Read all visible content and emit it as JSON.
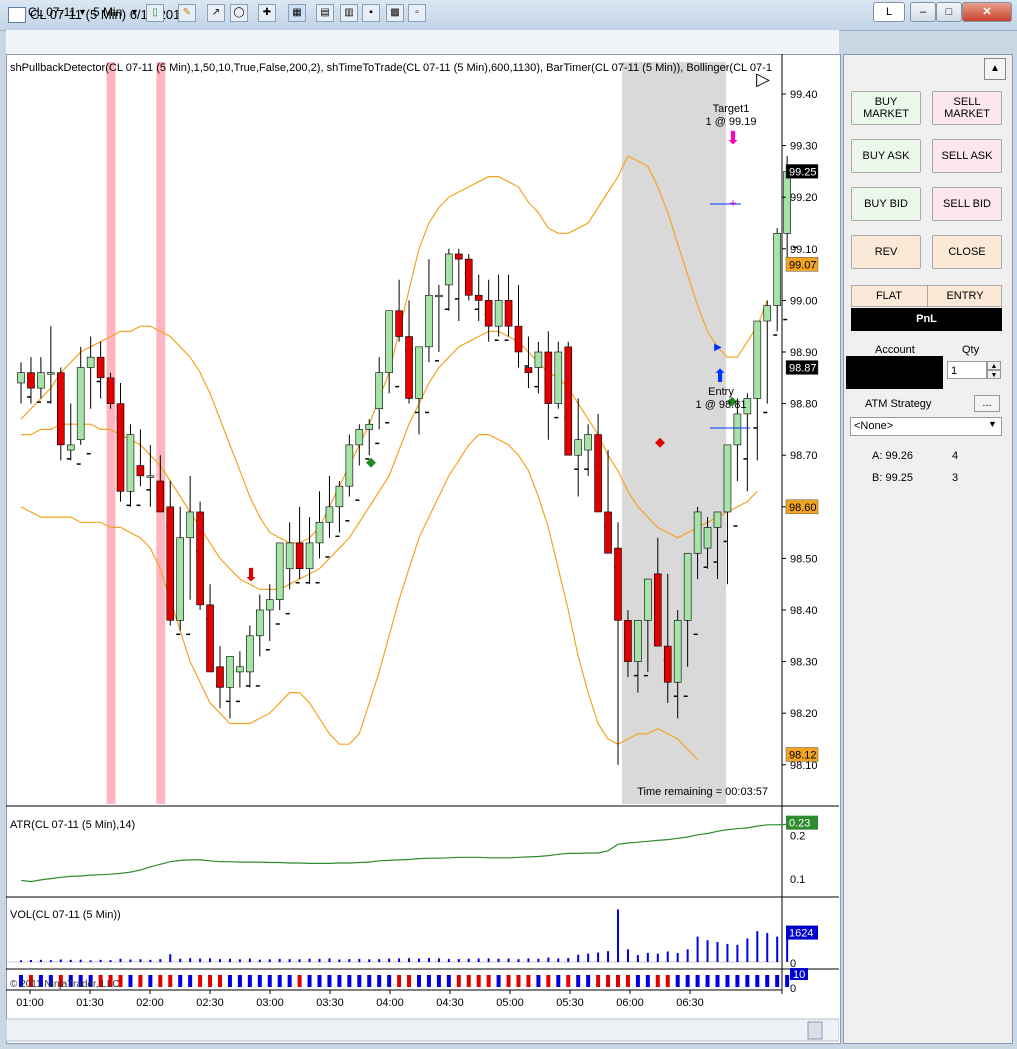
{
  "window": {
    "title": "CL 07-11 (5 Min)  6/15/2011",
    "link_button": "L"
  },
  "toolbar": {
    "instrument": "CL 07-11",
    "interval": "5 Min"
  },
  "chart": {
    "indicator_label": "shPullbackDetector(CL 07-11 (5 Min),1,50,10,True,False,200,2), shTimeToTrade(CL 07-11 (5 Min),600,1130), BarTimer(CL 07-11 (5 Min)), Bollinger(CL 07-1",
    "time_remaining": "Time remaining = 00:03:57",
    "target_label": "Target1",
    "target_qty": "1 @ 99.19",
    "entry_label": "Entry",
    "entry_qty": "1 @ 98.81",
    "copyright": "© 2011 NinjaTrader, LLC",
    "price_ticks": [
      "99.40",
      "99.30",
      "99.20",
      "99.10",
      "99.00",
      "98.90",
      "98.80",
      "98.70",
      "98.60",
      "98.50",
      "98.40",
      "98.30",
      "98.20",
      "98.10"
    ],
    "price_badges": [
      {
        "text": "99.25",
        "price": 99.25,
        "bg": "#000000",
        "fg": "#ffffff"
      },
      {
        "text": "99.07",
        "price": 99.07,
        "bg": "#f3a423",
        "fg": "#000000"
      },
      {
        "text": "98.87",
        "price": 98.87,
        "bg": "#000000",
        "fg": "#ffffff"
      },
      {
        "text": "98.60",
        "price": 98.6,
        "bg": "#f3a423",
        "fg": "#000000"
      },
      {
        "text": "98.12",
        "price": 98.12,
        "bg": "#f3a423",
        "fg": "#000000"
      }
    ],
    "time_labels": [
      "01:00",
      "01:30",
      "02:00",
      "02:30",
      "03:00",
      "03:30",
      "04:00",
      "04:30",
      "05:00",
      "05:30",
      "06:00",
      "06:30"
    ],
    "atr_label": "ATR(CL 07-11 (5 Min),14)",
    "atr_ticks": [
      "0.2",
      "0.1"
    ],
    "atr_badge": "0.23",
    "vol_label": "VOL(CL 07-11 (5 Min))",
    "vol_tick": "0",
    "vol_badge": "1624",
    "bottom_ticks": [
      "10",
      "0"
    ],
    "colors": {
      "up": "#a6e3a6",
      "down": "#e00000",
      "band": "#f3a423",
      "atr": "#2e8b2e",
      "vol": "#0000e0",
      "highlight": "#ffb6c1",
      "session": "#d9d9d9"
    }
  },
  "order_panel": {
    "buy_market": "BUY MARKET",
    "sell_market": "SELL MARKET",
    "buy_ask": "BUY ASK",
    "sell_ask": "SELL ASK",
    "buy_bid": "BUY BID",
    "sell_bid": "SELL BID",
    "rev": "REV",
    "close": "CLOSE",
    "flat": "FLAT",
    "entry": "ENTRY",
    "pnl": "PnL",
    "account_label": "Account",
    "qty_label": "Qty",
    "qty_value": "1",
    "atm_label": "ATM Strategy",
    "atm_more": "...",
    "atm_value": "<None>",
    "ask_label": "A: 99.26",
    "ask_size": "4",
    "bid_label": "B: 99.25",
    "bid_size": "3"
  },
  "chart_data": {
    "type": "candlestick",
    "title": "",
    "xlabel": "",
    "ylabel": "",
    "ylim": [
      98.06,
      99.5
    ],
    "x_ticks": [
      "01:00",
      "01:30",
      "02:00",
      "02:30",
      "03:00",
      "03:30",
      "04:00",
      "04:30",
      "05:00",
      "05:30",
      "06:00",
      "06:30"
    ],
    "bars_ohlc": [
      [
        98.84,
        98.88,
        98.8,
        98.86
      ],
      [
        98.86,
        98.89,
        98.8,
        98.83
      ],
      [
        98.83,
        98.89,
        98.81,
        98.86
      ],
      [
        98.86,
        98.95,
        98.8,
        98.86
      ],
      [
        98.86,
        98.87,
        98.69,
        98.72
      ],
      [
        98.71,
        98.8,
        98.69,
        98.72
      ],
      [
        98.73,
        98.91,
        98.72,
        98.87
      ],
      [
        98.87,
        98.93,
        98.79,
        98.89
      ],
      [
        98.89,
        98.92,
        98.81,
        98.85
      ],
      [
        98.85,
        98.86,
        98.79,
        98.8
      ],
      [
        98.8,
        98.84,
        98.61,
        98.63
      ],
      [
        98.63,
        98.76,
        98.6,
        98.74
      ],
      [
        98.68,
        98.75,
        98.64,
        98.66
      ],
      [
        98.66,
        98.72,
        98.6,
        98.66
      ],
      [
        98.65,
        98.7,
        98.6,
        98.59
      ],
      [
        98.6,
        98.65,
        98.37,
        98.38
      ],
      [
        98.38,
        98.6,
        98.36,
        98.54
      ],
      [
        98.54,
        98.66,
        98.42,
        98.59
      ],
      [
        98.59,
        98.61,
        98.4,
        98.41
      ],
      [
        98.41,
        98.45,
        98.35,
        98.28
      ],
      [
        98.29,
        98.33,
        98.21,
        98.25
      ],
      [
        98.25,
        98.31,
        98.19,
        98.31
      ],
      [
        98.28,
        98.32,
        98.25,
        98.29
      ],
      [
        98.28,
        98.37,
        98.25,
        98.35
      ],
      [
        98.35,
        98.43,
        98.31,
        98.4
      ],
      [
        98.4,
        98.45,
        98.34,
        98.42
      ],
      [
        98.42,
        98.53,
        98.4,
        98.53
      ],
      [
        98.48,
        98.57,
        98.44,
        98.53
      ],
      [
        98.53,
        98.6,
        98.46,
        98.48
      ],
      [
        98.48,
        98.58,
        98.45,
        98.53
      ],
      [
        98.53,
        98.63,
        98.5,
        98.57
      ],
      [
        98.57,
        98.66,
        98.54,
        98.6
      ],
      [
        98.6,
        98.65,
        98.55,
        98.64
      ],
      [
        98.64,
        98.74,
        98.62,
        98.72
      ],
      [
        98.72,
        98.76,
        98.68,
        98.75
      ],
      [
        98.75,
        98.77,
        98.7,
        98.76
      ],
      [
        98.79,
        98.89,
        98.75,
        98.86
      ],
      [
        98.86,
        98.97,
        98.82,
        98.98
      ],
      [
        98.98,
        99.04,
        98.92,
        98.93
      ],
      [
        98.93,
        99.0,
        98.8,
        98.81
      ],
      [
        98.81,
        98.91,
        98.74,
        98.91
      ],
      [
        98.91,
        99.08,
        98.88,
        99.01
      ],
      [
        99.01,
        99.03,
        98.9,
        99.01
      ],
      [
        99.03,
        99.1,
        98.98,
        99.09
      ],
      [
        99.09,
        99.1,
        98.96,
        99.08
      ],
      [
        99.08,
        99.09,
        99.0,
        99.01
      ],
      [
        99.01,
        99.05,
        98.96,
        99.0
      ],
      [
        99.0,
        99.04,
        98.92,
        98.95
      ],
      [
        98.95,
        99.05,
        98.93,
        99.0
      ],
      [
        99.0,
        99.05,
        98.93,
        98.95
      ],
      [
        98.95,
        99.03,
        98.87,
        98.9
      ],
      [
        98.87,
        98.93,
        98.83,
        98.86
      ],
      [
        98.87,
        98.92,
        98.82,
        98.9
      ],
      [
        98.9,
        98.94,
        98.73,
        98.8
      ],
      [
        98.8,
        98.92,
        98.79,
        98.9
      ],
      [
        98.91,
        98.92,
        98.72,
        98.7
      ],
      [
        98.7,
        98.81,
        98.62,
        98.73
      ],
      [
        98.71,
        98.76,
        98.66,
        98.74
      ],
      [
        98.74,
        98.78,
        98.6,
        98.59
      ],
      [
        98.59,
        98.71,
        98.52,
        98.51
      ],
      [
        98.52,
        98.57,
        98.1,
        98.38
      ],
      [
        98.38,
        98.4,
        98.27,
        98.3
      ],
      [
        98.3,
        98.38,
        98.24,
        98.38
      ],
      [
        98.38,
        98.45,
        98.28,
        98.46
      ],
      [
        98.47,
        98.54,
        98.34,
        98.33
      ],
      [
        98.33,
        98.47,
        98.22,
        98.26
      ],
      [
        98.26,
        98.4,
        98.19,
        98.38
      ],
      [
        98.38,
        98.5,
        98.29,
        98.51
      ],
      [
        98.51,
        98.6,
        98.46,
        98.59
      ],
      [
        98.52,
        98.58,
        98.48,
        98.56
      ],
      [
        98.56,
        98.59,
        98.46,
        98.59
      ],
      [
        98.59,
        98.67,
        98.45,
        98.72
      ],
      [
        98.72,
        98.81,
        98.65,
        98.78
      ],
      [
        98.78,
        98.82,
        98.63,
        98.81
      ],
      [
        98.81,
        98.9,
        98.69,
        98.96
      ],
      [
        98.96,
        99.0,
        98.8,
        98.99
      ],
      [
        98.99,
        99.14,
        98.94,
        99.13
      ],
      [
        99.13,
        99.28,
        99.08,
        99.25
      ]
    ],
    "atr_range": [
      0.07,
      0.25
    ],
    "atr_series": [
      0.097,
      0.094,
      0.098,
      0.101,
      0.104,
      0.106,
      0.107,
      0.109,
      0.11,
      0.111,
      0.113,
      0.116,
      0.121,
      0.128,
      0.134,
      0.14,
      0.143,
      0.144,
      0.144,
      0.142,
      0.14,
      0.14,
      0.139,
      0.139,
      0.139,
      0.138,
      0.138,
      0.137,
      0.137,
      0.136,
      0.136,
      0.136,
      0.137,
      0.137,
      0.138,
      0.139,
      0.142,
      0.143,
      0.144,
      0.145,
      0.147,
      0.148,
      0.148,
      0.149,
      0.15,
      0.15,
      0.15,
      0.149,
      0.149,
      0.149,
      0.15,
      0.151,
      0.152,
      0.154,
      0.157,
      0.159,
      0.159,
      0.16,
      0.16,
      0.165,
      0.18,
      0.183,
      0.185,
      0.187,
      0.189,
      0.191,
      0.194,
      0.197,
      0.202,
      0.205,
      0.21,
      0.214,
      0.216,
      0.218,
      0.222,
      0.225,
      0.225,
      0.226
    ],
    "vol_max": 3200,
    "vol_series": [
      90,
      110,
      120,
      100,
      140,
      120,
      130,
      90,
      120,
      100,
      180,
      140,
      150,
      120,
      160,
      430,
      180,
      210,
      190,
      200,
      160,
      180,
      150,
      190,
      130,
      150,
      170,
      160,
      150,
      180,
      170,
      200,
      140,
      160,
      170,
      150,
      160,
      190,
      200,
      210,
      190,
      220,
      200,
      170,
      160,
      180,
      190,
      200,
      180,
      190,
      160,
      200,
      180,
      240,
      200,
      220,
      400,
      460,
      520,
      600,
      2900,
      700,
      380,
      500,
      460,
      580,
      500,
      700,
      1400,
      1200,
      1100,
      1000,
      950,
      1300,
      1700,
      1600,
      1400,
      1624
    ],
    "upper_band": [
      98.77,
      98.79,
      98.81,
      98.83,
      98.86,
      98.88,
      98.9,
      98.91,
      98.92,
      98.93,
      98.94,
      98.94,
      98.95,
      98.95,
      98.94,
      98.93,
      98.91,
      98.89,
      98.86,
      98.82,
      98.77,
      98.72,
      98.67,
      98.62,
      98.58,
      98.55,
      98.54,
      98.53,
      98.53,
      98.54,
      98.56,
      98.6,
      98.64,
      98.68,
      98.72,
      98.76,
      98.81,
      98.86,
      98.94,
      99.02,
      99.1,
      99.15,
      99.18,
      99.2,
      99.21,
      99.22,
      99.23,
      99.24,
      99.24,
      99.23,
      99.22,
      99.19,
      99.17,
      99.14,
      99.13,
      99.13,
      99.14,
      99.15,
      99.18,
      99.21,
      99.24,
      99.28,
      99.27,
      99.26,
      99.22,
      99.17,
      99.11,
      99.05,
      98.99,
      98.94,
      98.91,
      98.89,
      98.89,
      98.92,
      98.95,
      99.0
    ],
    "mid_band": [
      98.74,
      98.74,
      98.75,
      98.75,
      98.76,
      98.76,
      98.76,
      98.76,
      98.75,
      98.75,
      98.74,
      98.73,
      98.72,
      98.7,
      98.68,
      98.65,
      98.62,
      98.59,
      98.56,
      98.53,
      98.5,
      98.48,
      98.46,
      98.45,
      98.44,
      98.44,
      98.44,
      98.45,
      98.46,
      98.47,
      98.48,
      98.5,
      98.52,
      98.54,
      98.57,
      98.6,
      98.63,
      98.66,
      98.71,
      98.76,
      98.8,
      98.84,
      98.87,
      98.89,
      98.91,
      98.92,
      98.93,
      98.94,
      98.94,
      98.93,
      98.92,
      98.9,
      98.88,
      98.86,
      98.85,
      98.83,
      98.8,
      98.77,
      98.74,
      98.7,
      98.67,
      98.63,
      98.6,
      98.58,
      98.56,
      98.55,
      98.54,
      98.55,
      98.56,
      98.57,
      98.58,
      98.59,
      98.6,
      98.61,
      98.63
    ],
    "lower_band": [
      98.6,
      98.59,
      98.58,
      98.58,
      98.58,
      98.58,
      98.57,
      98.57,
      98.57,
      98.56,
      98.56,
      98.55,
      98.54,
      98.52,
      98.48,
      98.42,
      98.36,
      98.3,
      98.26,
      98.22,
      98.2,
      98.18,
      98.18,
      98.18,
      98.19,
      98.2,
      98.22,
      98.24,
      98.24,
      98.22,
      98.19,
      98.16,
      98.14,
      98.14,
      98.16,
      98.22,
      98.28,
      98.35,
      98.42,
      98.48,
      98.54,
      98.58,
      98.62,
      98.66,
      98.69,
      98.72,
      98.74,
      98.74,
      98.73,
      98.72,
      98.7,
      98.67,
      98.62,
      98.56,
      98.48,
      98.4,
      98.31,
      98.24,
      98.18,
      98.15,
      98.14,
      98.15,
      98.16,
      98.16,
      98.17,
      98.16,
      98.15,
      98.13,
      98.11
    ],
    "highlight_bars": [
      9,
      14
    ],
    "session_start_bar": 61,
    "series": [
      {
        "name": "CL 07-11 (5 Min)"
      }
    ]
  }
}
